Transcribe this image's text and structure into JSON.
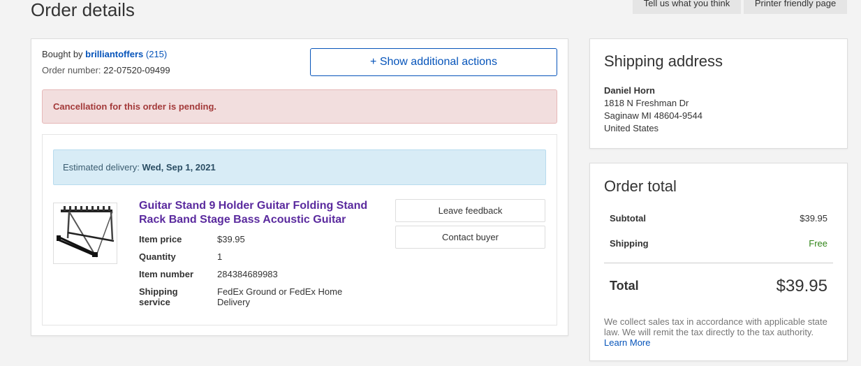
{
  "page": {
    "title": "Order details",
    "feedback_button": "Tell us what you think",
    "printer_button": "Printer friendly page"
  },
  "order": {
    "bought_by_label": "Bought by",
    "seller": "brilliantoffers",
    "seller_score_open": "(",
    "seller_score": "215",
    "seller_score_close": ")",
    "order_number_label": "Order number:",
    "order_number": "22-07520-09499",
    "actions_button": "+ Show additional actions",
    "cancel_alert": "Cancellation for this order is pending.",
    "delivery_label": "Estimated delivery:",
    "delivery_date": "Wed, Sep 1, 2021"
  },
  "item": {
    "title": "Guitar Stand 9 Holder Guitar Folding Stand Rack Band Stage Bass Acoustic Guitar",
    "price_label": "Item price",
    "price": "$39.95",
    "quantity_label": "Quantity",
    "quantity": "1",
    "number_label": "Item number",
    "number": "284384689983",
    "shipping_label": "Shipping service",
    "shipping": "FedEx Ground or FedEx Home Delivery",
    "leave_feedback": "Leave feedback",
    "contact_buyer": "Contact buyer"
  },
  "shipping_address": {
    "title": "Shipping address",
    "name": "Daniel Horn",
    "street": "1818 N Freshman Dr",
    "city": "Saginaw MI 48604-9544",
    "country": "United States"
  },
  "order_total": {
    "title": "Order total",
    "subtotal_label": "Subtotal",
    "subtotal": "$39.95",
    "shipping_label": "Shipping",
    "shipping": "Free",
    "total_label": "Total",
    "total": "$39.95",
    "tax_note": "We collect sales tax in accordance with applicable state law. We will remit the tax directly to the tax authority.",
    "learn_more": "Learn More"
  },
  "colors": {
    "link": "#0654ba",
    "alert_bg": "#f2dede",
    "alert_text": "#a33a3a",
    "info_bg": "#d8ecf6",
    "item_title": "#5a2a9e",
    "free": "#318518"
  }
}
